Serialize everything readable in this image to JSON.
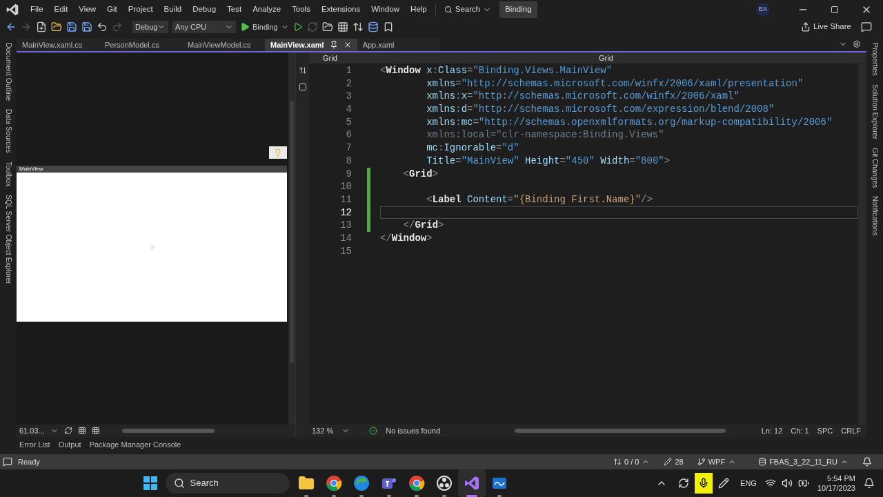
{
  "menu": [
    "File",
    "Edit",
    "View",
    "Git",
    "Project",
    "Build",
    "Debug",
    "Test",
    "Analyze",
    "Tools",
    "Extensions",
    "Window",
    "Help"
  ],
  "search": {
    "label": "Search"
  },
  "solution_name": "Binding",
  "account_initials": "EA",
  "toolbar": {
    "configuration": "Debug",
    "platform": "Any CPU",
    "start_target": "Binding"
  },
  "live_share": "Live Share",
  "left_strip": [
    "Document Outline",
    "Data Sources",
    "Toolbox",
    "SQL Server Object Explorer"
  ],
  "right_strip": [
    "Properties",
    "Solution Explorer",
    "Git Changes",
    "Notifications"
  ],
  "tabs": [
    {
      "label": "MainView.xaml.cs",
      "selected": false
    },
    {
      "label": "PersonModel.cs",
      "selected": false
    },
    {
      "label": "MainViewModel.cs",
      "selected": false
    },
    {
      "label": "MainView.xaml",
      "selected": true
    },
    {
      "label": "App.xaml",
      "selected": false
    }
  ],
  "designer": {
    "window_title": "MainView",
    "zoom": "61.03..."
  },
  "editor": {
    "nav_left": "Grid",
    "nav_right": "Grid",
    "zoom": "132 %",
    "issues": "No issues found",
    "lines": [
      {
        "number": "1",
        "modified": false,
        "current": false,
        "tokens": [
          {
            "kind": "punct",
            "text": "<"
          },
          {
            "kind": "element",
            "text": "Window"
          },
          {
            "kind": "attr",
            "text": " x"
          },
          {
            "kind": "punct",
            "text": ":"
          },
          {
            "kind": "attr",
            "text": "Class"
          },
          {
            "kind": "punct",
            "text": "="
          },
          {
            "kind": "value",
            "text": "\"Binding.Views.MainView\""
          }
        ]
      },
      {
        "number": "2",
        "modified": false,
        "current": false,
        "tokens": [
          {
            "kind": "attr",
            "text": "        xmlns"
          },
          {
            "kind": "punct",
            "text": "="
          },
          {
            "kind": "value",
            "text": "\"http://schemas.microsoft.com/winfx/2006/xaml/presentation\""
          }
        ]
      },
      {
        "number": "3",
        "modified": false,
        "current": false,
        "tokens": [
          {
            "kind": "attr",
            "text": "        xmlns"
          },
          {
            "kind": "punct",
            "text": ":"
          },
          {
            "kind": "attr",
            "text": "x"
          },
          {
            "kind": "punct",
            "text": "="
          },
          {
            "kind": "value",
            "text": "\"http://schemas.microsoft.com/winfx/2006/xaml\""
          }
        ]
      },
      {
        "number": "4",
        "modified": false,
        "current": false,
        "tokens": [
          {
            "kind": "attr",
            "text": "        xmlns"
          },
          {
            "kind": "punct",
            "text": ":"
          },
          {
            "kind": "attr",
            "text": "d"
          },
          {
            "kind": "punct",
            "text": "="
          },
          {
            "kind": "value",
            "text": "\"http://schemas.microsoft.com/expression/blend/2008\""
          }
        ]
      },
      {
        "number": "5",
        "modified": false,
        "current": false,
        "tokens": [
          {
            "kind": "attr",
            "text": "        xmlns"
          },
          {
            "kind": "punct",
            "text": ":"
          },
          {
            "kind": "attr",
            "text": "mc"
          },
          {
            "kind": "punct",
            "text": "="
          },
          {
            "kind": "value",
            "text": "\"http://schemas.openxmlformats.org/markup-compatibility/2006\""
          }
        ]
      },
      {
        "number": "6",
        "modified": false,
        "current": false,
        "tokens": [
          {
            "kind": "faded",
            "text": "        xmlns:local=\"clr-namespace:Binding.Views\""
          }
        ]
      },
      {
        "number": "7",
        "modified": false,
        "current": false,
        "tokens": [
          {
            "kind": "attr",
            "text": "        mc"
          },
          {
            "kind": "punct",
            "text": ":"
          },
          {
            "kind": "attr",
            "text": "Ignorable"
          },
          {
            "kind": "punct",
            "text": "="
          },
          {
            "kind": "value",
            "text": "\"d\""
          }
        ]
      },
      {
        "number": "8",
        "modified": false,
        "current": false,
        "tokens": [
          {
            "kind": "attr",
            "text": "        Title"
          },
          {
            "kind": "punct",
            "text": "="
          },
          {
            "kind": "value",
            "text": "\"MainView\""
          },
          {
            "kind": "attr",
            "text": " Height"
          },
          {
            "kind": "punct",
            "text": "="
          },
          {
            "kind": "value",
            "text": "\"450\""
          },
          {
            "kind": "attr",
            "text": " Width"
          },
          {
            "kind": "punct",
            "text": "="
          },
          {
            "kind": "value",
            "text": "\"800\""
          },
          {
            "kind": "punct",
            "text": ">"
          }
        ]
      },
      {
        "number": "9",
        "modified": true,
        "current": false,
        "tokens": [
          {
            "kind": "punct",
            "text": "    <"
          },
          {
            "kind": "element",
            "text": "Grid"
          },
          {
            "kind": "punct",
            "text": ">"
          }
        ]
      },
      {
        "number": "10",
        "modified": true,
        "current": false
      },
      {
        "number": "11",
        "modified": true,
        "current": false,
        "tokens": [
          {
            "kind": "punct",
            "text": "        <"
          },
          {
            "kind": "element",
            "text": "Label"
          },
          {
            "kind": "attr",
            "text": " Content"
          },
          {
            "kind": "punct",
            "text": "="
          },
          {
            "kind": "binding",
            "text": "\"{Binding First.Name}\""
          },
          {
            "kind": "punct",
            "text": "/>"
          }
        ]
      },
      {
        "number": "12",
        "modified": true,
        "current": true
      },
      {
        "number": "13",
        "modified": true,
        "current": false,
        "tokens": [
          {
            "kind": "punct",
            "text": "    </"
          },
          {
            "kind": "element",
            "text": "Grid"
          },
          {
            "kind": "punct",
            "text": ">"
          }
        ]
      },
      {
        "number": "14",
        "modified": false,
        "current": false,
        "tokens": [
          {
            "kind": "punct",
            "text": "</"
          },
          {
            "kind": "element",
            "text": "Window"
          },
          {
            "kind": "punct",
            "text": ">"
          }
        ]
      },
      {
        "number": "15",
        "modified": false,
        "current": false
      }
    ],
    "position": {
      "line": "Ln: 12",
      "char": "Ch: 1",
      "whitespace": "SPC",
      "line_ending": "CRLF"
    }
  },
  "bottom_tabs": [
    "Error List",
    "Output",
    "Package Manager Console"
  ],
  "status": {
    "text": "Ready",
    "sync": "0 / 0",
    "edits": "28",
    "branch": "WPF",
    "repo": "FBAS_3_22_11_RU"
  },
  "taskbar": {
    "search": "Search",
    "language": "ENG",
    "time": "5:54 PM",
    "date": "10/17/2023",
    "apps": [
      {
        "kind": "explorer",
        "active": false
      },
      {
        "kind": "chrome",
        "active": false
      },
      {
        "kind": "edge",
        "active": false
      },
      {
        "kind": "teams",
        "active": false
      },
      {
        "kind": "chrome",
        "active": false
      },
      {
        "kind": "obs",
        "active": false
      },
      {
        "kind": "visualstudio",
        "active": true
      },
      {
        "kind": "whiteboard",
        "active": false
      }
    ]
  }
}
